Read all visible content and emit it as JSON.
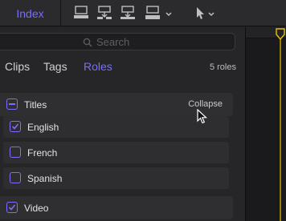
{
  "toolbar": {
    "index_label": "Index",
    "icons": [
      "append-clip-icon",
      "insert-clip-icon",
      "connect-clip-icon",
      "overwrite-clip-icon",
      "select-tool-icon"
    ]
  },
  "search": {
    "placeholder": "Search",
    "value": ""
  },
  "tabs": [
    {
      "label": "Clips",
      "active": false
    },
    {
      "label": "Tags",
      "active": false
    },
    {
      "label": "Roles",
      "active": true
    }
  ],
  "roles_count": "5 roles",
  "groups": [
    {
      "title": "Titles",
      "state": "mixed",
      "action": "Collapse",
      "items": [
        {
          "label": "English",
          "checked": true
        },
        {
          "label": "French",
          "checked": false
        },
        {
          "label": "Spanish",
          "checked": false
        }
      ]
    },
    {
      "title": "Video",
      "state": "checked"
    }
  ],
  "colors": {
    "accent": "#7a6dff",
    "playhead": "#e8c100"
  }
}
